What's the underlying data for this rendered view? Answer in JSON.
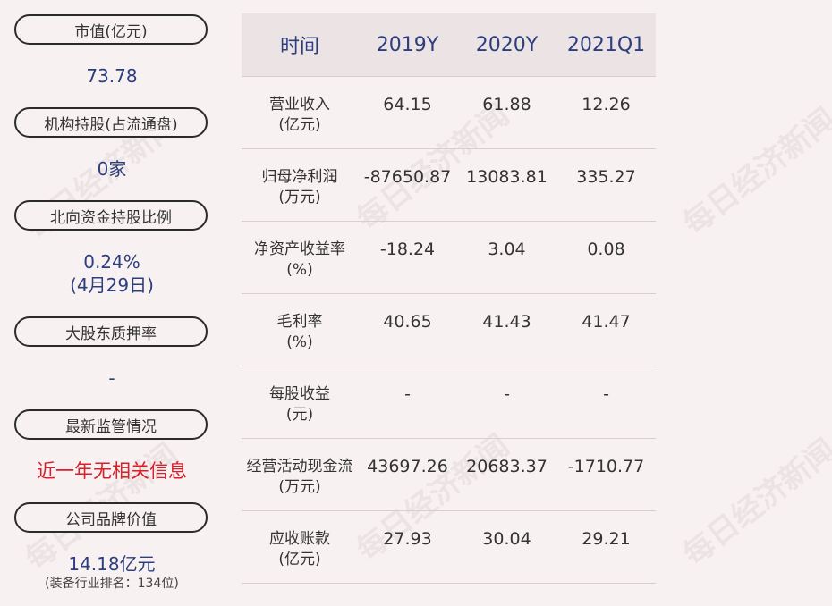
{
  "left_panel": [
    {
      "label": "市值(亿元)",
      "value": "73.78"
    },
    {
      "label": "机构持股(占流通盘)",
      "value": "0家"
    },
    {
      "label": "北向资金持股比例",
      "value": "0.24%",
      "value2": "(4月29日)"
    },
    {
      "label": "大股东质押率",
      "value": "-"
    },
    {
      "label": "最新监管情况",
      "value": "近一年无相关信息"
    },
    {
      "label": "公司品牌价值",
      "value": "14.18亿元",
      "note": "(装备行业排名：134位)"
    }
  ],
  "table": {
    "headers": [
      "时间",
      "2019Y",
      "2020Y",
      "2021Q1"
    ],
    "rows": [
      {
        "label1": "营业收入",
        "label2": "(亿元)",
        "values": [
          "64.15",
          "61.88",
          "12.26"
        ]
      },
      {
        "label1": "归母净利润",
        "label2": "(万元)",
        "values": [
          "-87650.87",
          "13083.81",
          "335.27"
        ]
      },
      {
        "label1": "净资产收益率",
        "label2": "(%)",
        "values": [
          "-18.24",
          "3.04",
          "0.08"
        ]
      },
      {
        "label1": "毛利率",
        "label2": "(%)",
        "values": [
          "40.65",
          "41.43",
          "41.47"
        ]
      },
      {
        "label1": "每股收益",
        "label2": "(元)",
        "values": [
          "-",
          "-",
          "-"
        ]
      },
      {
        "label1": "经营活动现金流",
        "label2": "(万元)",
        "values": [
          "43697.26",
          "20683.37",
          "-1710.77"
        ]
      },
      {
        "label1": "应收账款",
        "label2": "(亿元)",
        "values": [
          "27.93",
          "30.04",
          "29.21"
        ]
      }
    ]
  },
  "watermark": "每日经济新闻",
  "colors": {
    "background": "#f8f1f1",
    "header_bg": "#ebe3e4",
    "value_blue": "#2d3e7e",
    "alert_red": "#d9202a"
  }
}
